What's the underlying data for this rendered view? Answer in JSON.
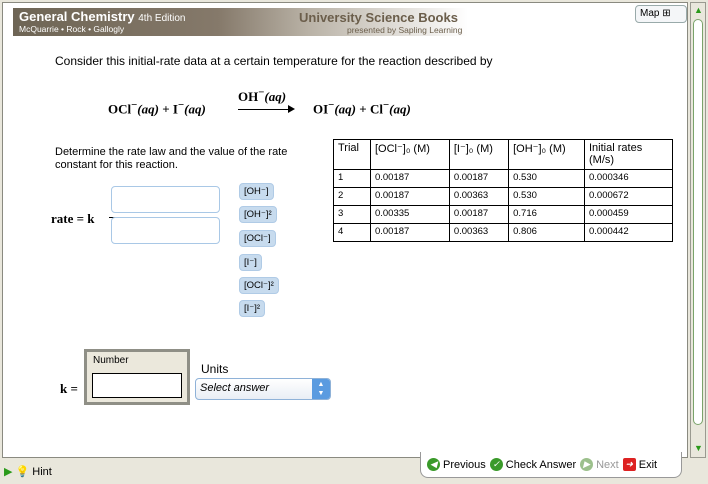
{
  "banner": {
    "title": "General Chemistry",
    "edition": "4th Edition",
    "authors": "McQuarrie • Rock • Gallogly",
    "publisher": "University Science Books",
    "presented": "presented by Sapling Learning"
  },
  "map_label": "Map",
  "prompt": "Consider this initial-rate data at a certain temperature for the reaction described by",
  "equation": {
    "r1": "OCl",
    "r1c": "−",
    "r1s": "(aq)",
    "plus": " + ",
    "r2": "I",
    "r2c": "−",
    "r2s": "(aq)",
    "cat": "OH",
    "catc": "−",
    "cats": "(aq)",
    "p1": "OI",
    "p1c": "−",
    "p1s": "(aq)",
    "p2": "Cl",
    "p2c": "−",
    "p2s": "(aq)"
  },
  "instructions": "Determine the rate law and the value of the rate constant for this reaction.",
  "table": {
    "headers": [
      "Trial",
      "[OCl⁻]₀ (M)",
      "[I⁻]₀ (M)",
      "[OH⁻]₀ (M)",
      "Initial rates (M/s)"
    ],
    "rows": [
      [
        "1",
        "0.00187",
        "0.00187",
        "0.530",
        "0.000346"
      ],
      [
        "2",
        "0.00187",
        "0.00363",
        "0.530",
        "0.000672"
      ],
      [
        "3",
        "0.00335",
        "0.00187",
        "0.716",
        "0.000459"
      ],
      [
        "4",
        "0.00187",
        "0.00363",
        "0.806",
        "0.000442"
      ]
    ]
  },
  "rate_label": "rate = k",
  "chips": [
    "[OH⁻]",
    "[OH⁻]²",
    "[OCl⁻]",
    "[I⁻]",
    "[OCl⁻]²",
    "[I⁻]²"
  ],
  "k_label": "k =",
  "number_label": "Number",
  "number_value": "",
  "units_label": "Units",
  "units_select": "Select answer",
  "nav": {
    "previous": "Previous",
    "check": "Check Answer",
    "next": "Next",
    "exit": "Exit"
  },
  "hint": "Hint"
}
